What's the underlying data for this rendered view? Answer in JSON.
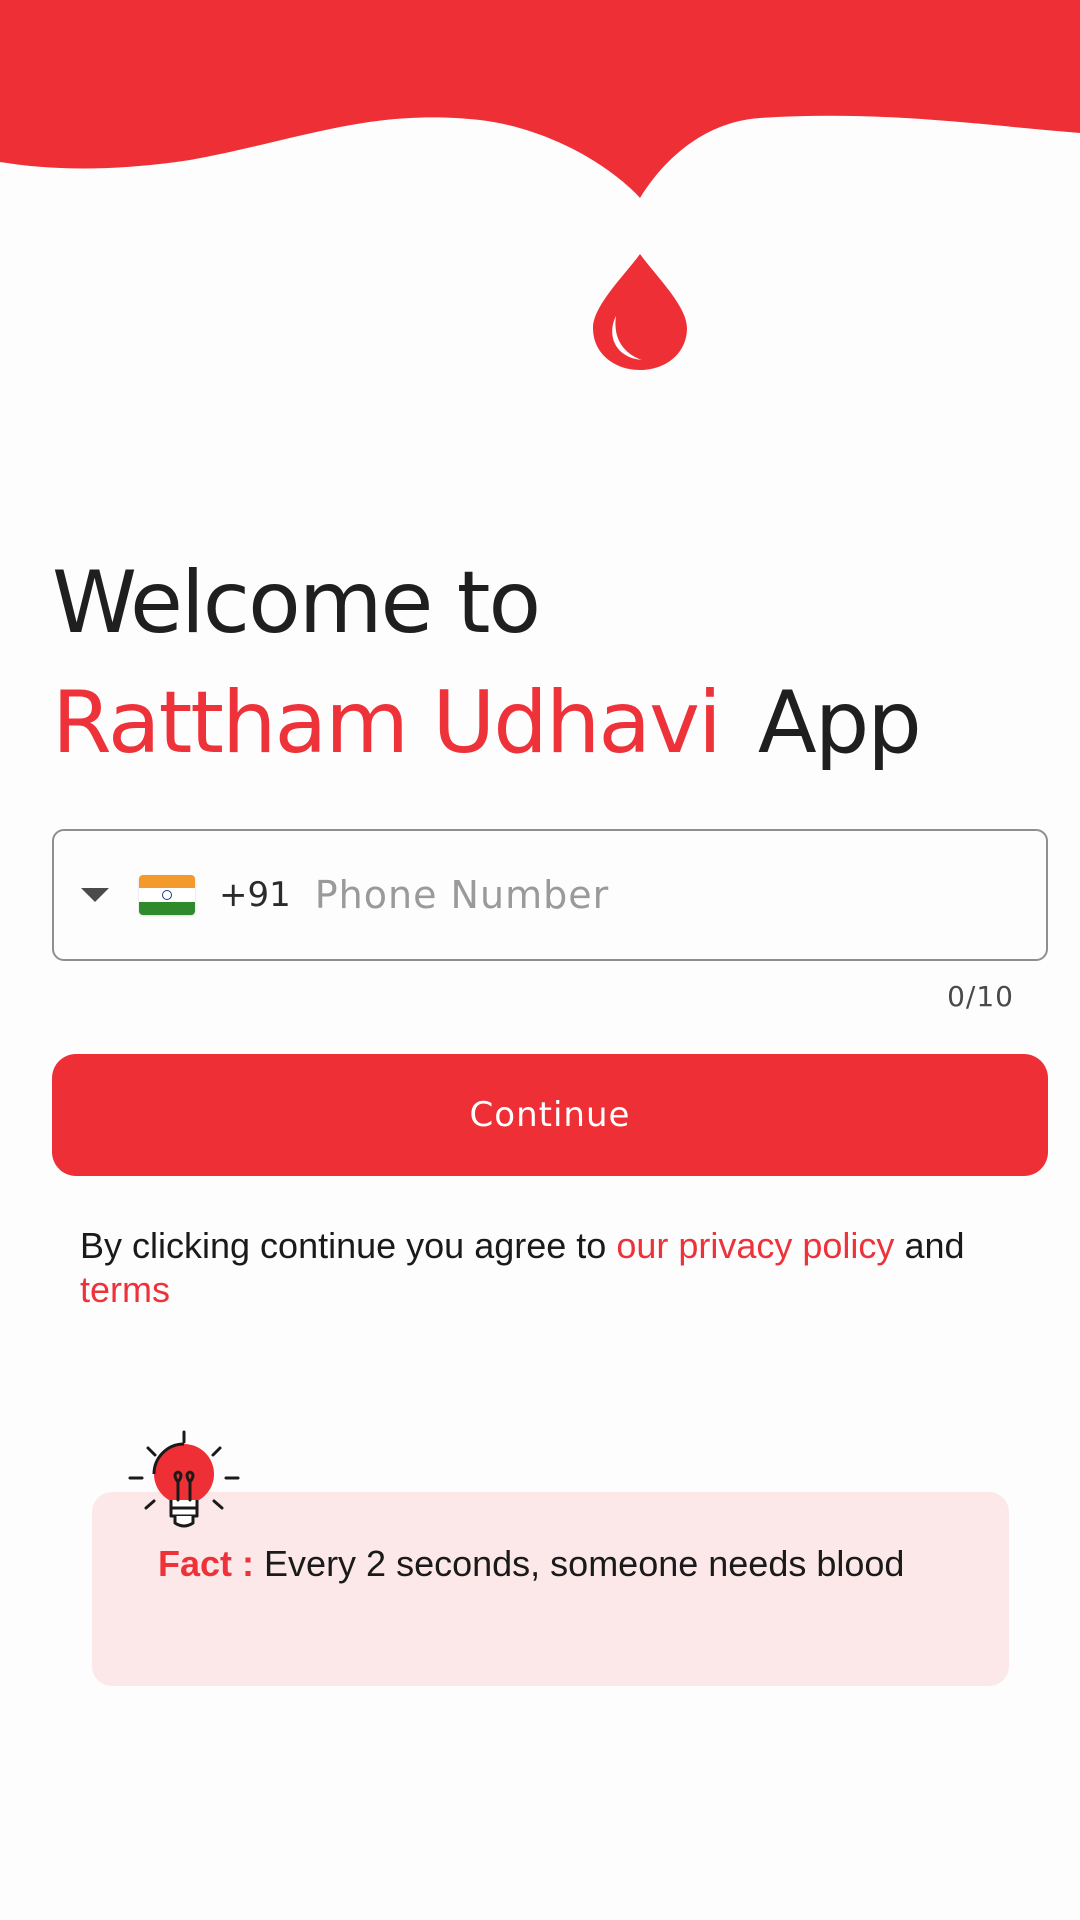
{
  "welcome": {
    "line1": "Welcome to",
    "brand": "Rattham Udhavi",
    "suffix": "App"
  },
  "phone": {
    "country_flag": "india-flag-icon",
    "dial_code": "+91",
    "placeholder": "Phone Number",
    "value": "",
    "counter": "0/10"
  },
  "actions": {
    "continue_label": "Continue"
  },
  "agreement": {
    "prefix": "By clicking continue you agree to",
    "privacy_link": "our privacy policy",
    "conjunction": "and",
    "terms_link": "terms"
  },
  "fact": {
    "label": "Fact :",
    "text": "Every 2 seconds, someone needs blood"
  },
  "icons": {
    "logo": "blood-drop-icon",
    "fact": "lightbulb-icon",
    "dropdown": "caret-down-icon"
  },
  "colors": {
    "primary": "#ee3036",
    "fact_background": "#fde8e9",
    "text": "#1f1f1f"
  }
}
